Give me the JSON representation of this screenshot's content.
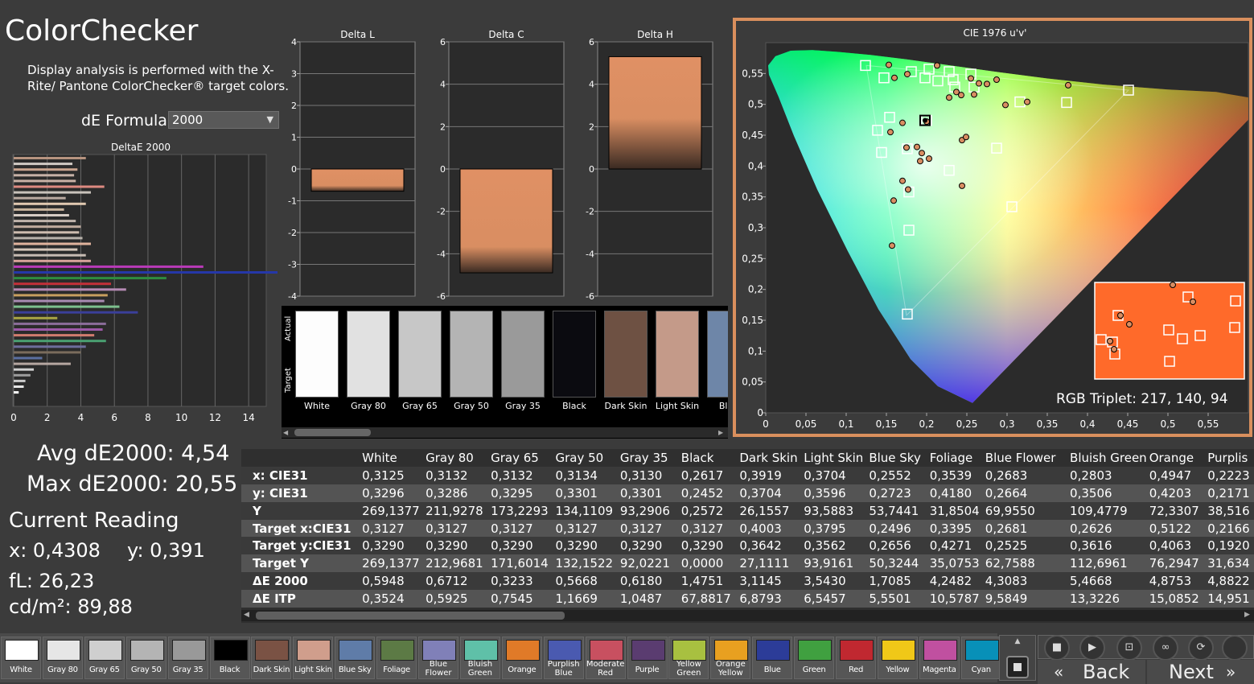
{
  "app": {
    "title": "ColorChecker",
    "description": "Display analysis is performed with the X-Rite/ Pantone ColorChecker® target colors.",
    "formula_label": "dE Formula:",
    "formula_value": "2000"
  },
  "stats": {
    "avg": "Avg dE2000: 4,54",
    "max": "Max dE2000: 20,55",
    "current_reading_title": "Current Reading",
    "x": "x: 0,4308",
    "y": "y: 0,391",
    "fl": "fL: 26,23",
    "cdm2": "cd/m²: 89,88"
  },
  "chart_data": [
    {
      "type": "bar",
      "title": "DeltaE 2000",
      "orientation": "horizontal",
      "xlim": [
        0,
        15
      ],
      "x_ticks": [
        "0",
        "2",
        "4",
        "6",
        "8",
        "10",
        "12",
        "14"
      ],
      "values": [
        4.3,
        3.5,
        3.8,
        3.6,
        3.7,
        5.4,
        4.6,
        3.1,
        4.3,
        3.0,
        3.3,
        3.7,
        4.0,
        3.9,
        4.1,
        4.6,
        3.8,
        4.3,
        4.6,
        11.3,
        20.6,
        9.1,
        5.8,
        6.7,
        5.6,
        5.4,
        6.3,
        7.4,
        2.6,
        5.5,
        5.3,
        4.8,
        5.5,
        4.3,
        4.0,
        1.7,
        3.4,
        1.2,
        1.0,
        0.7,
        0.6,
        0.3
      ],
      "colors": [
        "#b6937f",
        "#cfc9c3",
        "#c9a48f",
        "#c7b2a7",
        "#c9b1a5",
        "#dd8a80",
        "#c8c2bb",
        "#b8a9a0",
        "#e0c8b0",
        "#c9b49d",
        "#d7ccc4",
        "#bfb3ab",
        "#c0ab9e",
        "#cdbcaf",
        "#b7b1aa",
        "#e0b39d",
        "#d4c5b8",
        "#c7bcb3",
        "#d7a49a",
        "#b93ab8",
        "#2537a8",
        "#2f8c3f",
        "#c33039",
        "#b58ab3",
        "#c89f5f",
        "#a88bb2",
        "#7dc08d",
        "#3a3f9a",
        "#a7a444",
        "#8b6d9a",
        "#9c59a8",
        "#d17c6e",
        "#4aa072",
        "#6d6d9c",
        "#7a6c5c",
        "#5b6fa0",
        "#b5a6a0",
        "#cfcfcf",
        "#9c9c9c",
        "#c9c9c9",
        "#e6e6e6",
        "#ffffff"
      ]
    },
    {
      "type": "bar",
      "title": "Delta L",
      "categories": [
        "Delta L"
      ],
      "values": [
        -0.7
      ],
      "ylim": [
        -4,
        4
      ],
      "y_ticks": [
        "4",
        "3",
        "2",
        "1",
        "0",
        "-1",
        "-2",
        "-3",
        "-4"
      ]
    },
    {
      "type": "bar",
      "title": "Delta C",
      "categories": [
        "Delta C"
      ],
      "values": [
        -4.9
      ],
      "ylim": [
        -6,
        6
      ],
      "y_ticks": [
        "6",
        "4",
        "2",
        "0",
        "-2",
        "-4",
        "-6"
      ]
    },
    {
      "type": "bar",
      "title": "Delta H",
      "categories": [
        "Delta H"
      ],
      "values": [
        5.3
      ],
      "ylim": [
        -6,
        6
      ],
      "y_ticks": [
        "6",
        "4",
        "2",
        "0",
        "-2",
        "-4",
        "-6"
      ]
    },
    {
      "type": "scatter",
      "title": "CIE 1976 u'v'",
      "xlim": [
        0,
        0.6
      ],
      "ylim": [
        0,
        0.6
      ],
      "x_ticks": [
        "0",
        "0,05",
        "0,1",
        "0,15",
        "0,2",
        "0,25",
        "0,3",
        "0,35",
        "0,4",
        "0,45",
        "0,5",
        "0,55"
      ],
      "y_ticks": [
        "0,05",
        "0,1",
        "0,15",
        "0,2",
        "0,25",
        "0,3",
        "0,35",
        "0,4",
        "0,45",
        "0,5",
        "0,55",
        "0"
      ],
      "gamut_triangle": {
        "red": [
          0.451,
          0.523
        ],
        "green": [
          0.125,
          0.563
        ],
        "blue": [
          0.175,
          0.158
        ]
      },
      "targets": [
        [
          0.124,
          0.563
        ],
        [
          0.147,
          0.543
        ],
        [
          0.181,
          0.553
        ],
        [
          0.203,
          0.557
        ],
        [
          0.228,
          0.553
        ],
        [
          0.255,
          0.549
        ],
        [
          0.198,
          0.543
        ],
        [
          0.214,
          0.538
        ],
        [
          0.235,
          0.528
        ],
        [
          0.259,
          0.528
        ],
        [
          0.316,
          0.504
        ],
        [
          0.374,
          0.503
        ],
        [
          0.451,
          0.523
        ],
        [
          0.2,
          0.474
        ],
        [
          0.154,
          0.479
        ],
        [
          0.139,
          0.458
        ],
        [
          0.176,
          0.428
        ],
        [
          0.144,
          0.422
        ],
        [
          0.228,
          0.393
        ],
        [
          0.287,
          0.429
        ],
        [
          0.178,
          0.358
        ],
        [
          0.306,
          0.334
        ],
        [
          0.178,
          0.296
        ],
        [
          0.176,
          0.16
        ],
        [
          0.233,
          0.54
        ]
      ],
      "measured": [
        [
          0.153,
          0.564
        ],
        [
          0.213,
          0.563
        ],
        [
          0.176,
          0.549
        ],
        [
          0.16,
          0.543
        ],
        [
          0.255,
          0.542
        ],
        [
          0.275,
          0.533
        ],
        [
          0.265,
          0.534
        ],
        [
          0.287,
          0.54
        ],
        [
          0.376,
          0.531
        ],
        [
          0.237,
          0.52
        ],
        [
          0.243,
          0.515
        ],
        [
          0.228,
          0.511
        ],
        [
          0.259,
          0.516
        ],
        [
          0.325,
          0.504
        ],
        [
          0.298,
          0.499
        ],
        [
          0.17,
          0.47
        ],
        [
          0.2,
          0.472
        ],
        [
          0.155,
          0.455
        ],
        [
          0.175,
          0.43
        ],
        [
          0.188,
          0.431
        ],
        [
          0.194,
          0.421
        ],
        [
          0.203,
          0.412
        ],
        [
          0.244,
          0.442
        ],
        [
          0.249,
          0.447
        ],
        [
          0.192,
          0.408
        ],
        [
          0.17,
          0.376
        ],
        [
          0.177,
          0.362
        ],
        [
          0.159,
          0.344
        ],
        [
          0.244,
          0.368
        ],
        [
          0.157,
          0.271
        ]
      ],
      "reading": [
        0.198,
        0.474
      ],
      "rgb_triplet": "RGB Triplet: 217, 140, 94"
    }
  ],
  "swatch_panel": {
    "actual_label": "Actual",
    "target_label": "Target",
    "swatches": [
      {
        "label": "White",
        "color": "#fdfdfd"
      },
      {
        "label": "Gray 80",
        "color": "#e1e1e1"
      },
      {
        "label": "Gray 65",
        "color": "#c7c7c7"
      },
      {
        "label": "Gray 50",
        "color": "#b4b4b4"
      },
      {
        "label": "Gray 35",
        "color": "#9a9a9a"
      },
      {
        "label": "Black",
        "color": "#0b0b10"
      },
      {
        "label": "Dark Skin",
        "color": "#6e5143"
      },
      {
        "label": "Light Skin",
        "color": "#c49a89"
      },
      {
        "label": "Blue",
        "color": "#6e86a8"
      }
    ]
  },
  "table": {
    "columns": [
      "White",
      "Gray 80",
      "Gray 65",
      "Gray 50",
      "Gray 35",
      "Black",
      "Dark Skin",
      "Light Skin",
      "Blue Sky",
      "Foliage",
      "Blue Flower",
      "Bluish Green",
      "Orange",
      "Purplis"
    ],
    "rows": [
      {
        "label": "x: CIE31",
        "values": [
          "0,3125",
          "0,3132",
          "0,3132",
          "0,3134",
          "0,3130",
          "0,2617",
          "0,3919",
          "0,3704",
          "0,2552",
          "0,3539",
          "0,2683",
          "0,2803",
          "0,4947",
          "0,2223"
        ]
      },
      {
        "label": "y: CIE31",
        "values": [
          "0,3296",
          "0,3286",
          "0,3295",
          "0,3301",
          "0,3301",
          "0,2452",
          "0,3704",
          "0,3596",
          "0,2723",
          "0,4180",
          "0,2664",
          "0,3506",
          "0,4203",
          "0,2171"
        ]
      },
      {
        "label": "Y",
        "values": [
          "269,1377",
          "211,9278",
          "173,2293",
          "134,1109",
          "93,2906",
          "0,2572",
          "26,1557",
          "93,5883",
          "53,7441",
          "31,8504",
          "69,9550",
          "109,4779",
          "72,3307",
          "38,516"
        ]
      },
      {
        "label": "Target x:CIE31",
        "values": [
          "0,3127",
          "0,3127",
          "0,3127",
          "0,3127",
          "0,3127",
          "0,3127",
          "0,4003",
          "0,3795",
          "0,2496",
          "0,3395",
          "0,2681",
          "0,2626",
          "0,5122",
          "0,2166"
        ]
      },
      {
        "label": "Target y:CIE31",
        "values": [
          "0,3290",
          "0,3290",
          "0,3290",
          "0,3290",
          "0,3290",
          "0,3290",
          "0,3642",
          "0,3562",
          "0,2656",
          "0,4271",
          "0,2525",
          "0,3616",
          "0,4063",
          "0,1920"
        ]
      },
      {
        "label": "Target Y",
        "values": [
          "269,1377",
          "212,9681",
          "171,6014",
          "132,1522",
          "92,0221",
          "0,0000",
          "27,1111",
          "93,9161",
          "50,3244",
          "35,0753",
          "62,7588",
          "112,6961",
          "76,2947",
          "31,634"
        ]
      },
      {
        "label": "ΔE 2000",
        "values": [
          "0,5948",
          "0,6712",
          "0,3233",
          "0,5668",
          "0,6180",
          "1,4751",
          "3,1145",
          "3,5430",
          "1,7085",
          "4,2482",
          "4,3083",
          "5,4668",
          "4,8753",
          "4,8822"
        ]
      },
      {
        "label": "ΔE ITP",
        "values": [
          "0,3524",
          "0,5925",
          "0,7545",
          "1,1669",
          "1,0487",
          "67,8817",
          "6,8793",
          "6,5457",
          "5,5501",
          "10,5787",
          "9,5849",
          "13,3226",
          "15,0852",
          "14,951"
        ]
      }
    ]
  },
  "palette": [
    {
      "label": "White",
      "color": "#ffffff"
    },
    {
      "label": "Gray 80",
      "color": "#e6e6e6"
    },
    {
      "label": "Gray 65",
      "color": "#cfcfcf"
    },
    {
      "label": "Gray 50",
      "color": "#b4b4b4"
    },
    {
      "label": "Gray 35",
      "color": "#999999"
    },
    {
      "label": "Black",
      "color": "#000000"
    },
    {
      "label": "Dark Skin",
      "color": "#7a5244"
    },
    {
      "label": "Light Skin",
      "color": "#d09e8c"
    },
    {
      "label": "Blue Sky",
      "color": "#5f7ca8"
    },
    {
      "label": "Foliage",
      "color": "#5c7a45"
    },
    {
      "label": "Blue Flower",
      "color": "#8080b8"
    },
    {
      "label": "Bluish Green",
      "color": "#5fc0a8"
    },
    {
      "label": "Orange",
      "color": "#e07a28"
    },
    {
      "label": "Purplish Blue",
      "color": "#4a5ab0"
    },
    {
      "label": "Moderate Red",
      "color": "#c85060"
    },
    {
      "label": "Purple",
      "color": "#5a3c70"
    },
    {
      "label": "Yellow Green",
      "color": "#a8c040"
    },
    {
      "label": "Orange Yellow",
      "color": "#e8a020"
    },
    {
      "label": "Blue",
      "color": "#2c3c98"
    },
    {
      "label": "Green",
      "color": "#40a040"
    },
    {
      "label": "Red",
      "color": "#c02830"
    },
    {
      "label": "Yellow",
      "color": "#f0c818"
    },
    {
      "label": "Magenta",
      "color": "#c050a0"
    },
    {
      "label": "Cyan",
      "color": "#0890b8"
    }
  ],
  "nav": {
    "back": "Back",
    "next": "Next"
  }
}
